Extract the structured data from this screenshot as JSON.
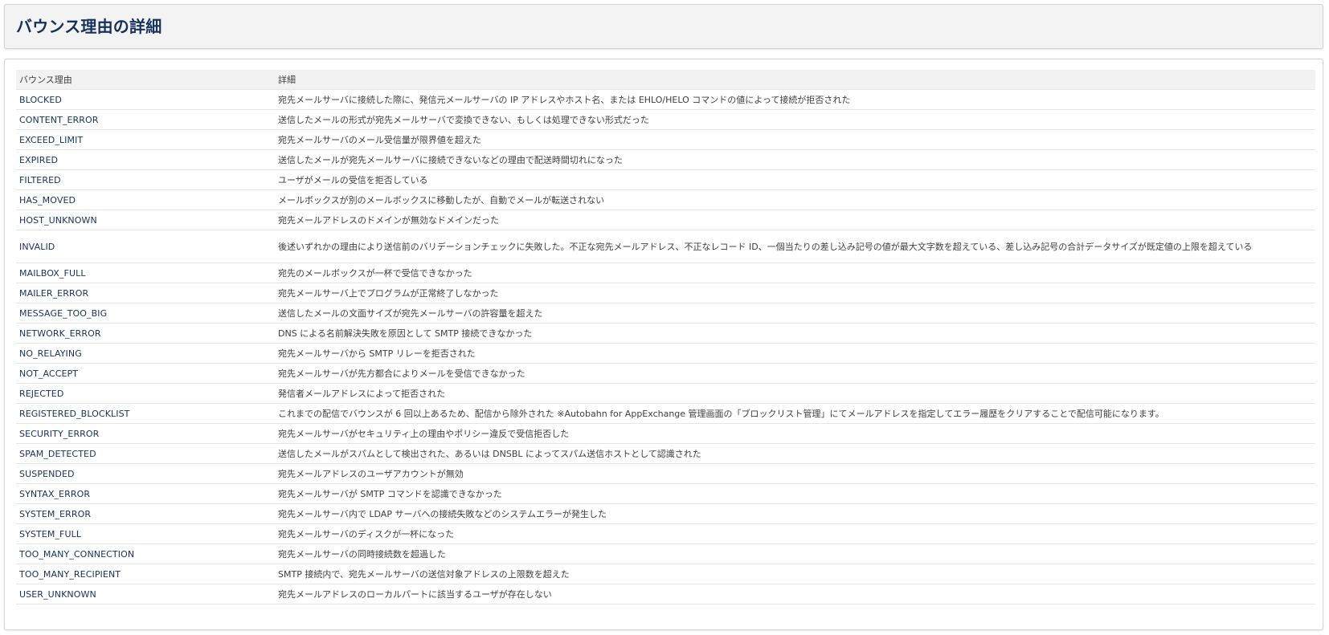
{
  "header": {
    "title": "バウンス理由の詳細"
  },
  "table": {
    "columns": [
      "バウンス理由",
      "詳細"
    ],
    "rows": [
      {
        "reason": "BLOCKED",
        "detail": "宛先メールサーバに接続した際に、発信元メールサーバの IP アドレスやホスト名、または EHLO/HELO コマンドの値によって接続が拒否された"
      },
      {
        "reason": "CONTENT_ERROR",
        "detail": "送信したメールの形式が宛先メールサーバで変換できない、もしくは処理できない形式だった"
      },
      {
        "reason": "EXCEED_LIMIT",
        "detail": "宛先メールサーバのメール受信量が限界値を超えた"
      },
      {
        "reason": "EXPIRED",
        "detail": "送信したメールが宛先メールサーバに接続できないなどの理由で配送時間切れになった"
      },
      {
        "reason": "FILTERED",
        "detail": "ユーザがメールの受信を拒否している"
      },
      {
        "reason": "HAS_MOVED",
        "detail": "メールボックスが別のメールボックスに移動したが、自動でメールが転送されない"
      },
      {
        "reason": "HOST_UNKNOWN",
        "detail": "宛先メールアドレスのドメインが無効なドメインだった"
      },
      {
        "reason": "INVALID",
        "detail": "後述いずれかの理由により送信前のバリデーションチェックに失敗した。不正な宛先メールアドレス、不正なレコード ID、一個当たりの差し込み記号の値が最大文字数を超えている、差し込み記号の合計データサイズが既定値の上限を超えている"
      },
      {
        "reason": "MAILBOX_FULL",
        "detail": "宛先のメールボックスが一杯で受信できなかった"
      },
      {
        "reason": "MAILER_ERROR",
        "detail": "宛先メールサーバ上でプログラムが正常終了しなかった"
      },
      {
        "reason": "MESSAGE_TOO_BIG",
        "detail": "送信したメールの文面サイズが宛先メールサーバの許容量を超えた"
      },
      {
        "reason": "NETWORK_ERROR",
        "detail": "DNS による名前解決失敗を原因として SMTP 接続できなかった"
      },
      {
        "reason": "NO_RELAYING",
        "detail": "宛先メールサーバから SMTP リレーを拒否された"
      },
      {
        "reason": "NOT_ACCEPT",
        "detail": "宛先メールサーバが先方都合によりメールを受信できなかった"
      },
      {
        "reason": "REJECTED",
        "detail": "発信者メールアドレスによって拒否された"
      },
      {
        "reason": "REGISTERED_BLOCKLIST",
        "detail": "これまでの配信でバウンスが 6 回以上あるため、配信から除外された ※Autobahn for AppExchange 管理画面の「ブロックリスト管理」にてメールアドレスを指定してエラー履歴をクリアすることで配信可能になります。"
      },
      {
        "reason": "SECURITY_ERROR",
        "detail": "宛先メールサーバがセキュリティ上の理由やポリシー違反で受信拒否した"
      },
      {
        "reason": "SPAM_DETECTED",
        "detail": "送信したメールがスパムとして検出された、あるいは DNSBL によってスパム送信ホストとして認識された"
      },
      {
        "reason": "SUSPENDED",
        "detail": "宛先メールアドレスのユーザアカウントが無効"
      },
      {
        "reason": "SYNTAX_ERROR",
        "detail": "宛先メールサーバが SMTP コマンドを認識できなかった"
      },
      {
        "reason": "SYSTEM_ERROR",
        "detail": "宛先メールサーバ内で LDAP サーバへの接続失敗などのシステムエラーが発生した"
      },
      {
        "reason": "SYSTEM_FULL",
        "detail": "宛先メールサーバのディスクが一杯になった"
      },
      {
        "reason": "TOO_MANY_CONNECTION",
        "detail": "宛先メールサーバの同時接続数を超過した"
      },
      {
        "reason": "TOO_MANY_RECIPIENT",
        "detail": "SMTP 接続内で、宛先メールサーバの送信対象アドレスの上限数を超えた"
      },
      {
        "reason": "USER_UNKNOWN",
        "detail": "宛先メールアドレスのローカルパートに該当するユーザが存在しない"
      }
    ]
  },
  "colors": {
    "title": "#16325c",
    "header_bg": "#f3f3f3",
    "table_header_bg": "#f2f2f2",
    "reason_text": "#16325c",
    "detail_text": "#3e3e3c",
    "row_border": "#e6e6e6"
  }
}
